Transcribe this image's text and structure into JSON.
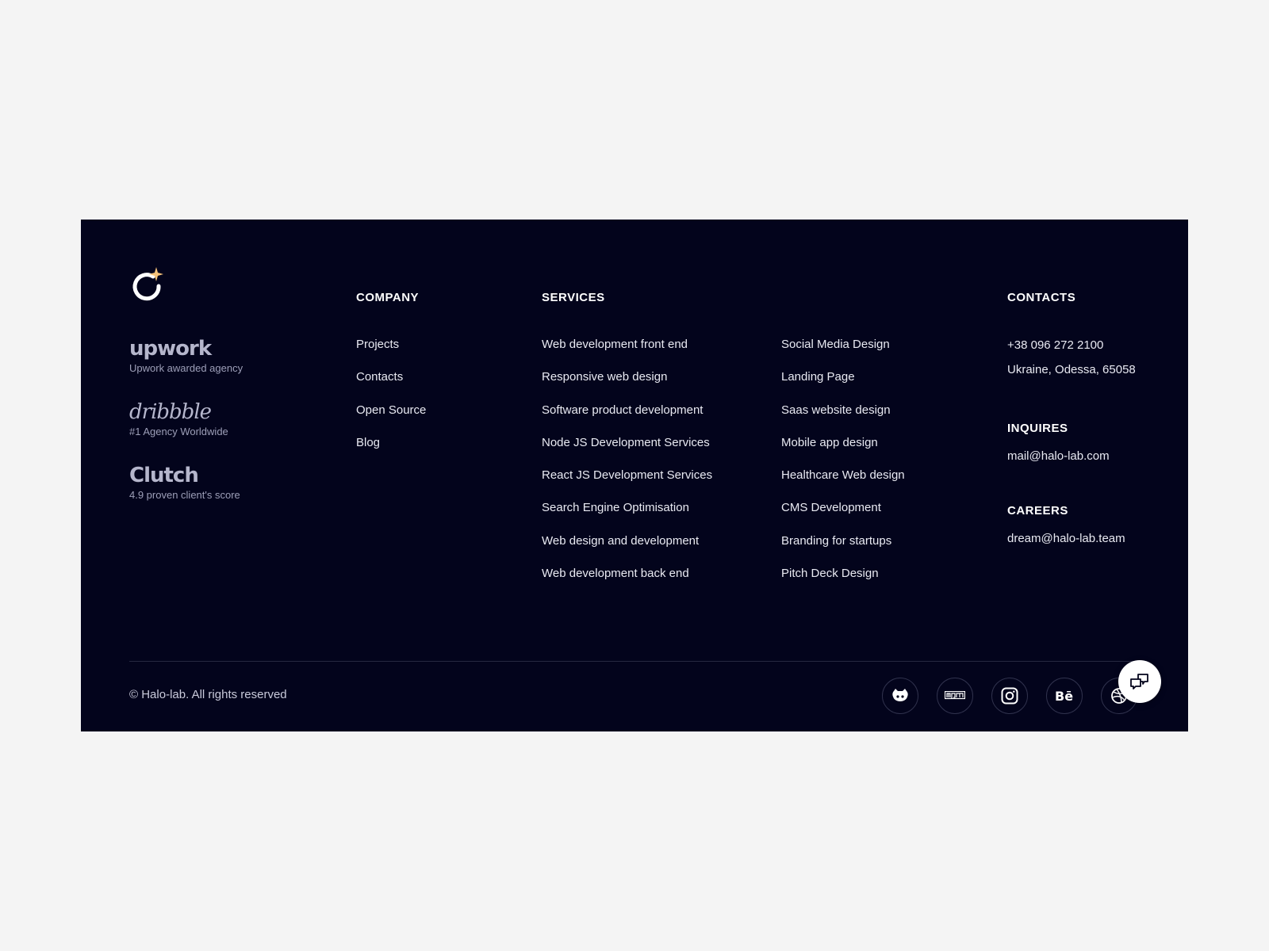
{
  "brand": {
    "logo_icon": "halo-lab-logo-icon",
    "accent_color": "#f5c27a",
    "background": "#03041c"
  },
  "badges": [
    {
      "brand": "upwork",
      "caption": "Upwork awarded agency"
    },
    {
      "brand": "dribbble",
      "caption": "#1 Agency Worldwide"
    },
    {
      "brand": "Clutch",
      "caption": "4.9 proven client's score"
    }
  ],
  "company": {
    "heading": "COMPANY",
    "links": [
      "Projects",
      "Contacts",
      "Open Source",
      "Blog"
    ]
  },
  "services": {
    "heading": "SERVICES",
    "column1": [
      "Web development front end",
      "Responsive web design",
      "Software product development",
      "Node JS Development Services",
      "React JS Development Services",
      "Search Engine Optimisation",
      "Web design and development",
      "Web development back end"
    ],
    "column2": [
      "Social Media Design",
      "Landing Page",
      "Saas website design",
      "Mobile app design",
      "Healthcare Web design",
      "CMS Development",
      "Branding for startups",
      "Pitch Deck Design"
    ]
  },
  "contacts": {
    "heading": "CONTACTS",
    "phone": "+38 096 272 2100",
    "address": "Ukraine, Odessa, 65058",
    "inquires_heading": "INQUIRES",
    "inquires_email": "mail@halo-lab.com",
    "careers_heading": "CAREERS",
    "careers_email": "dream@halo-lab.team"
  },
  "bottom": {
    "copyright": "© Halo-lab. All rights reserved",
    "socials": [
      "github-icon",
      "npm-icon",
      "instagram-icon",
      "behance-icon",
      "dribbble-icon"
    ],
    "chat_icon": "chat-bubbles-icon"
  }
}
